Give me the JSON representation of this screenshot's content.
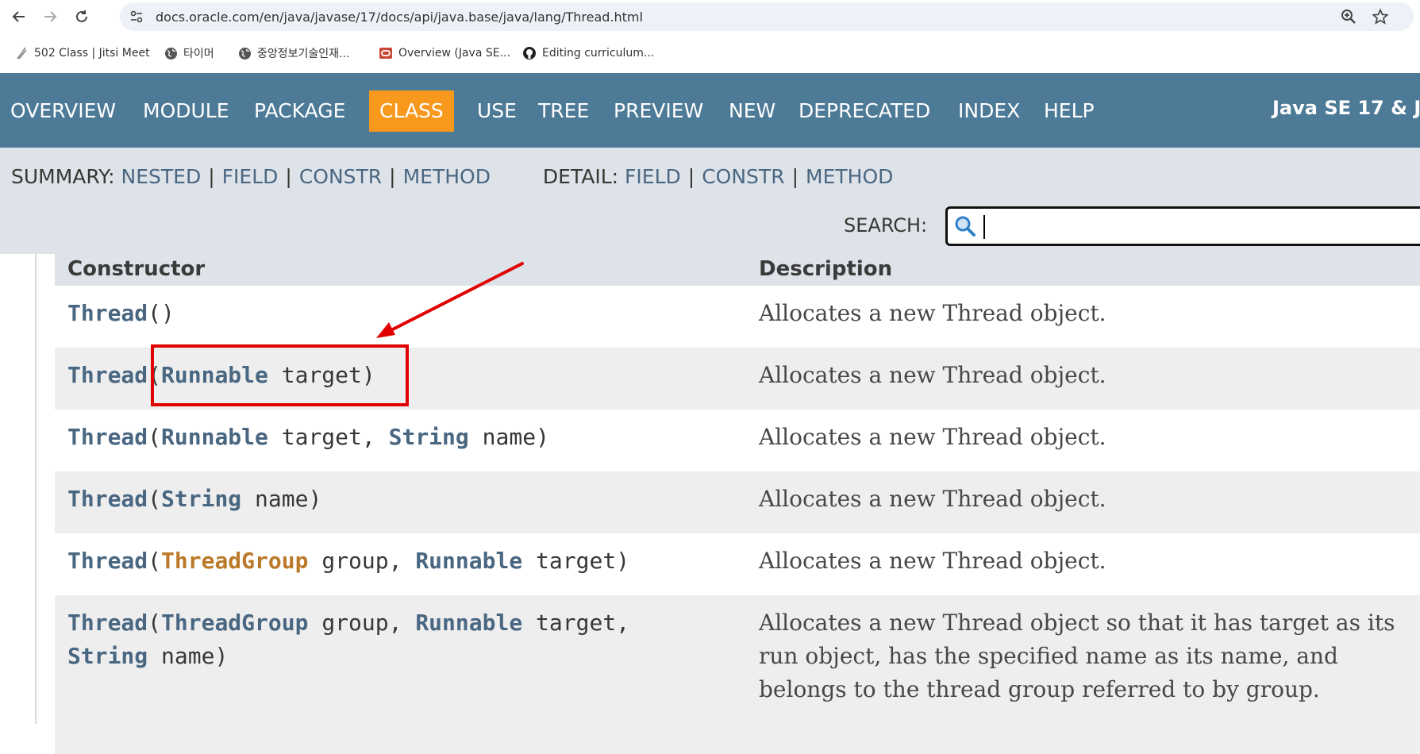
{
  "browser": {
    "url": "docs.oracle.com/en/java/javase/17/docs/api/java.base/java/lang/Thread.html",
    "nav_icons": [
      "back-icon",
      "forward-icon",
      "reload-icon",
      "site-info-icon",
      "zoom-icon",
      "star-icon"
    ],
    "bookmarks": [
      {
        "label": "502 Class | Jitsi Meet",
        "icon": "jitsi-icon"
      },
      {
        "label": "타이머",
        "icon": "globe-icon"
      },
      {
        "label": "중앙정보기술인재...",
        "icon": "globe-icon"
      },
      {
        "label": "Overview (Java SE...",
        "icon": "oracle-icon"
      },
      {
        "label": "Editing curriculum...",
        "icon": "github-icon"
      }
    ]
  },
  "topnav": {
    "items": [
      "OVERVIEW",
      "MODULE",
      "PACKAGE",
      "CLASS",
      "USE",
      "TREE",
      "PREVIEW",
      "NEW",
      "DEPRECATED",
      "INDEX",
      "HELP"
    ],
    "active": "CLASS",
    "about_language": "Java SE 17 & J"
  },
  "subnav": {
    "summary_label": "SUMMARY:",
    "summary_links": [
      "NESTED",
      "FIELD",
      "CONSTR",
      "METHOD"
    ],
    "detail_label": "DETAIL:",
    "detail_links": [
      "FIELD",
      "CONSTR",
      "METHOD"
    ],
    "separator": "|",
    "search_label": "SEARCH:",
    "search_value": ""
  },
  "constructors_table": {
    "headers": [
      "Constructor",
      "Description"
    ],
    "rows": [
      {
        "name": "Thread",
        "open": "(",
        "params": [],
        "close": ")",
        "description": "Allocates a new Thread object."
      },
      {
        "name": "Thread",
        "open": "(",
        "params": [
          {
            "type": "Runnable",
            "name": "target"
          }
        ],
        "close": ")",
        "description": "Allocates a new Thread object."
      },
      {
        "name": "Thread",
        "open": "(",
        "params": [
          {
            "type": "Runnable",
            "name": "target"
          },
          {
            "type": "String",
            "name": "name"
          }
        ],
        "close": ")",
        "description": "Allocates a new Thread object."
      },
      {
        "name": "Thread",
        "open": "(",
        "params": [
          {
            "type": "String",
            "name": "name"
          }
        ],
        "close": ")",
        "description": "Allocates a new Thread object."
      },
      {
        "name": "Thread",
        "open": "(",
        "params": [
          {
            "type": "ThreadGroup",
            "name": "group"
          },
          {
            "type": "Runnable",
            "name": "target"
          }
        ],
        "close": ")",
        "description": "Allocates a new Thread object."
      },
      {
        "name": "Thread",
        "open": "(",
        "params": [
          {
            "type": "ThreadGroup",
            "name": "group"
          },
          {
            "type": "Runnable",
            "name": "target"
          },
          {
            "type": "String",
            "name": "name"
          }
        ],
        "close": ")",
        "description": "Allocates a new Thread object so that it has target as its run object, has the specified name as its name, and belongs to the thread group referred to by group."
      }
    ]
  },
  "colors": {
    "nav_bg": "#4d7a97",
    "active_tab": "#f8981d",
    "subnav_bg": "#dee3e9",
    "link": "#4a6782",
    "threadgroup_link": "#bb7a2a",
    "annotation": "#e00000"
  }
}
